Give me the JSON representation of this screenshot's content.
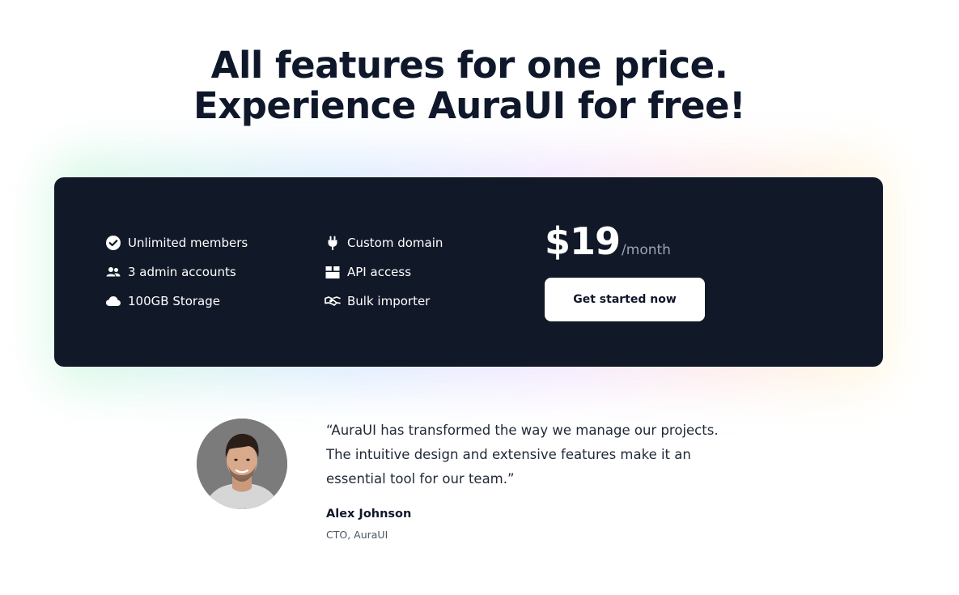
{
  "headline": {
    "line1": "All features for one price.",
    "line2": "Experience AuraUI for free!"
  },
  "pricing": {
    "features_left": [
      {
        "label": "Unlimited members",
        "icon": "check-circle-icon"
      },
      {
        "label": "3 admin accounts",
        "icon": "users-icon"
      },
      {
        "label": "100GB Storage",
        "icon": "cloud-icon"
      }
    ],
    "features_right": [
      {
        "label": "Custom domain",
        "icon": "plug-icon"
      },
      {
        "label": "API access",
        "icon": "package-icon"
      },
      {
        "label": "Bulk importer",
        "icon": "handshake-icon"
      }
    ],
    "price": "$19",
    "period": "/month",
    "cta_label": "Get started now"
  },
  "testimonial": {
    "quote_lines": [
      "“AuraUI has transformed the way we manage our projects.",
      "The intuitive design and extensive features make it an",
      "essential tool for our team.”"
    ],
    "author_name": "Alex Johnson",
    "author_role": "CTO, AuraUI"
  },
  "colors": {
    "card_background": "#111827",
    "headline_text": "#0f172a",
    "button_background": "#ffffff",
    "price_period_text": "#9ca3af"
  }
}
